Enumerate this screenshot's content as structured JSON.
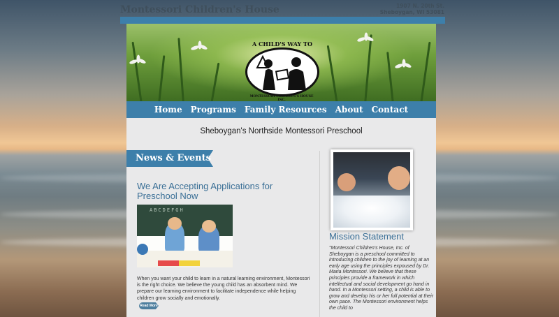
{
  "header": {
    "site_title": "Montessori Children's House",
    "address_line1": "1907 N. 20th St.",
    "address_line2": "Sheboygan, WI 53081"
  },
  "hero": {
    "logo_arc_text": "A CHILD'S WAY TO LEARN",
    "logo_bottom_text": "MONTESSORI CHILDREN'S HOUSE INC."
  },
  "nav": {
    "items": [
      "Home",
      "Programs",
      "Family Resources",
      "About",
      "Contact"
    ]
  },
  "tagline": "Sheboygan's Northside Montessori Preschool",
  "news": {
    "heading": "News & Events",
    "post_title": "We Are Accepting Applications for Preschool Now",
    "post_text": "When you want your child to learn in a natural learning environment, Montessori is the right choice. We believe the young child has an absorbent mind. We prepare our learning environment to facilitate independence while helping children grow socially and emotionally.",
    "read_more": "Read More",
    "chalkboard_text": "ABCDEFGH"
  },
  "mission": {
    "title": "Mission Statement",
    "text": "\"Montessori Children's House, Inc. of Sheboygan is a preschool committed to introducing children to the joy of learning at an early age using the principles expoused by Dr. Maria Montessori. We believe that these principles provide a framework in which intellectual and social development go hand in hand. In a Montessori setting, a child is able to grow and develop his or her full potential at their own pace. The Montessori environment helps the child to"
  },
  "colors": {
    "accent_blue": "#3d7faa",
    "title_blue": "#3a6f96",
    "page_bg": "#e9e9ea"
  }
}
